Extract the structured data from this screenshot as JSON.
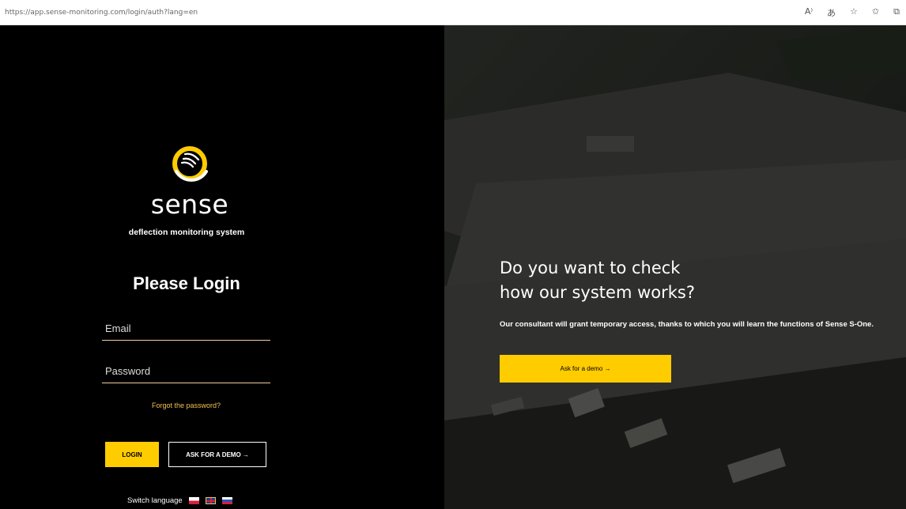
{
  "browser": {
    "url": "https://app.sense-monitoring.com/login/auth?lang=en",
    "icons": [
      "read-aloud-icon",
      "translate-icon",
      "add-favorite-icon",
      "favorites-icon",
      "collections-icon"
    ]
  },
  "login": {
    "logo_text": "sense",
    "tagline": "deflection monitoring system",
    "title": "Please Login",
    "email_placeholder": "Email",
    "password_placeholder": "Password",
    "forgot_label": "Forgot the password?",
    "login_label": "LOGIN",
    "demo_label": "ASK FOR A DEMO →",
    "switch_language_label": "Switch language",
    "languages": [
      "pl",
      "en",
      "ru"
    ]
  },
  "hero": {
    "headline_line1": "Do you want to check",
    "headline_line2": "how our system works?",
    "subtext": "Our consultant will grant temporary access, thanks to which you will learn the functions of Sense S-One.",
    "button_label": "Ask for a demo →"
  },
  "colors": {
    "accent": "#ffcc00",
    "panel_bg": "#000000",
    "field_underline": "#f0cf9c",
    "forgot_link": "#f2c14e"
  }
}
